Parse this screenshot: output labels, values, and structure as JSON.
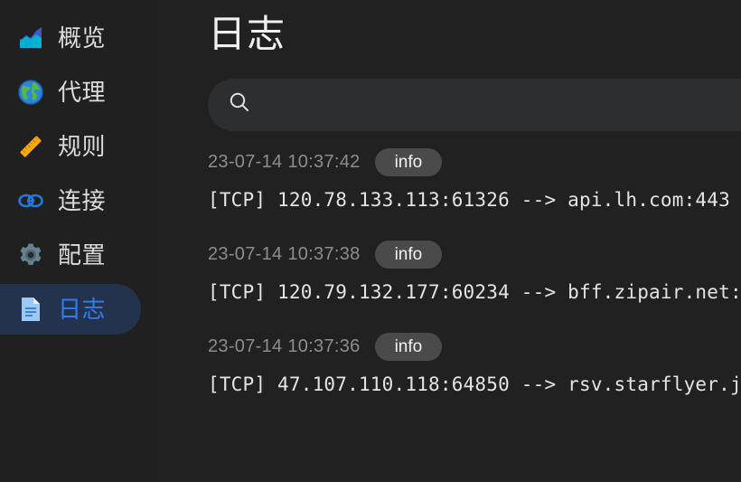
{
  "sidebar": {
    "items": [
      {
        "label": "概览",
        "icon": "area-chart-icon",
        "key": "overview",
        "active": false
      },
      {
        "label": "代理",
        "icon": "globe-icon",
        "key": "proxies",
        "active": false
      },
      {
        "label": "规则",
        "icon": "ruler-icon",
        "key": "rules",
        "active": false
      },
      {
        "label": "连接",
        "icon": "links-icon",
        "key": "connections",
        "active": false
      },
      {
        "label": "配置",
        "icon": "gear-icon",
        "key": "config",
        "active": false
      },
      {
        "label": "日志",
        "icon": "document-icon",
        "key": "logs",
        "active": true
      }
    ]
  },
  "header": {
    "title": "日志"
  },
  "search": {
    "value": "",
    "placeholder": "",
    "icon": "search-icon"
  },
  "logs": {
    "entries": [
      {
        "time": "23-07-14 10:37:42",
        "level": "info",
        "message": "[TCP] 120.78.133.113:61326 --> api.lh.com:443"
      },
      {
        "time": "23-07-14 10:37:38",
        "level": "info",
        "message": "[TCP] 120.79.132.177:60234 --> bff.zipair.net:"
      },
      {
        "time": "23-07-14 10:37:36",
        "level": "info",
        "message": "[TCP] 47.107.110.118:64850 --> rsv.starflyer.j"
      }
    ]
  },
  "colors": {
    "app_background": "#212121",
    "sidebar_background": "#202020",
    "accent_blue": "#2f7ef0",
    "active_pill": "#23334e",
    "badge_grey": "#4a4a4a",
    "search_field": "#2d2e30",
    "label_text": "#dcdcdc",
    "muted_text": "#8d8d8d"
  }
}
